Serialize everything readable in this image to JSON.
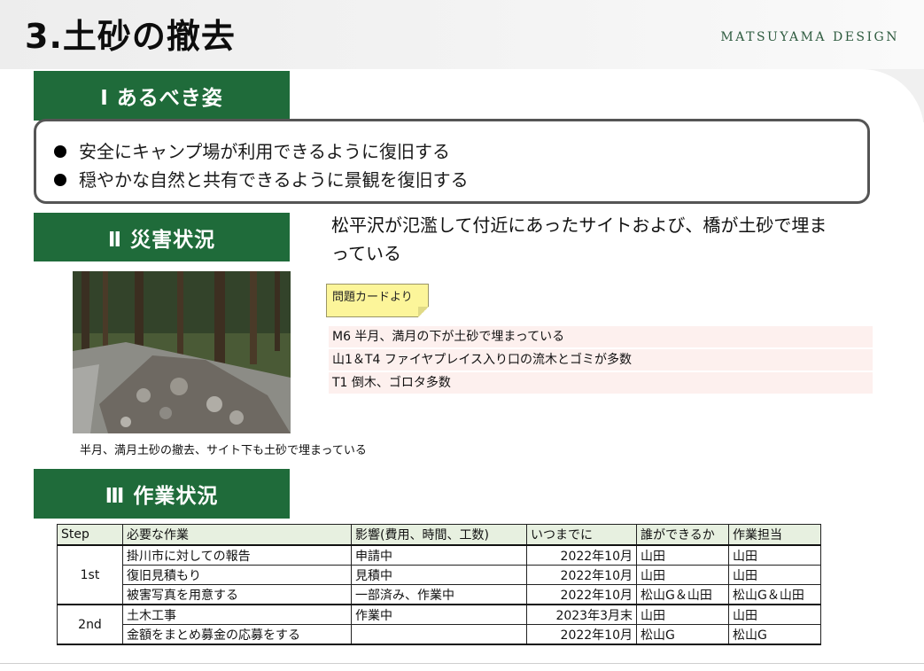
{
  "header": {
    "title": "3.土砂の撤去",
    "brand": "MATSUYAMA DESIGN"
  },
  "section1": {
    "heading": "Ⅰ あるべき姿",
    "items": [
      "安全にキャンプ場が利用できるように復旧する",
      "穏やかな自然と共有できるように景観を復旧する"
    ]
  },
  "section2": {
    "heading": "Ⅱ 災害状況",
    "description": "松平沢が氾濫して付近にあったサイトおよび、橋が土砂で埋まっている",
    "photo_caption": "半月、満月土砂の撤去、サイト下も土砂で埋まっている",
    "note_label": "問題カードより",
    "problems": [
      "M6 半月、満月の下が土砂で埋まっている",
      "山1＆T4 ファイヤプレイス入り口の流木とゴミが多数",
      "T1 倒木、ゴロタ多数"
    ]
  },
  "section3": {
    "heading": "Ⅲ 作業状況",
    "columns": [
      "Step",
      "必要な作業",
      "影響(費用、時間、工数)",
      "いつまでに",
      "誰ができるか",
      "作業担当"
    ],
    "groups": [
      {
        "step": "1st",
        "rows": [
          {
            "task": "掛川市に対しての報告",
            "impact": "申請中",
            "due": "2022年10月",
            "who": "山田",
            "owner": "山田"
          },
          {
            "task": "復旧見積もり",
            "impact": "見積中",
            "due": "2022年10月",
            "who": "山田",
            "owner": "山田"
          },
          {
            "task": "被害写真を用意する",
            "impact": "一部済み、作業中",
            "due": "2022年10月",
            "who": "松山G＆山田",
            "owner": "松山G＆山田"
          }
        ]
      },
      {
        "step": "2nd",
        "rows": [
          {
            "task": "土木工事",
            "impact": "作業中",
            "due": "2023年3月末",
            "who": "山田",
            "owner": "山田"
          },
          {
            "task": "金額をまとめ募金の応募をする",
            "impact": "",
            "due": "2022年10月",
            "who": "松山G",
            "owner": "松山G"
          }
        ]
      }
    ]
  },
  "colors": {
    "section_green": "#1f6b3a",
    "brand_green": "#2d5a3e",
    "table_header_bg": "#e7f0e0",
    "problem_row_bg": "#fdf0ee",
    "note_yellow": "#fcf59a"
  }
}
